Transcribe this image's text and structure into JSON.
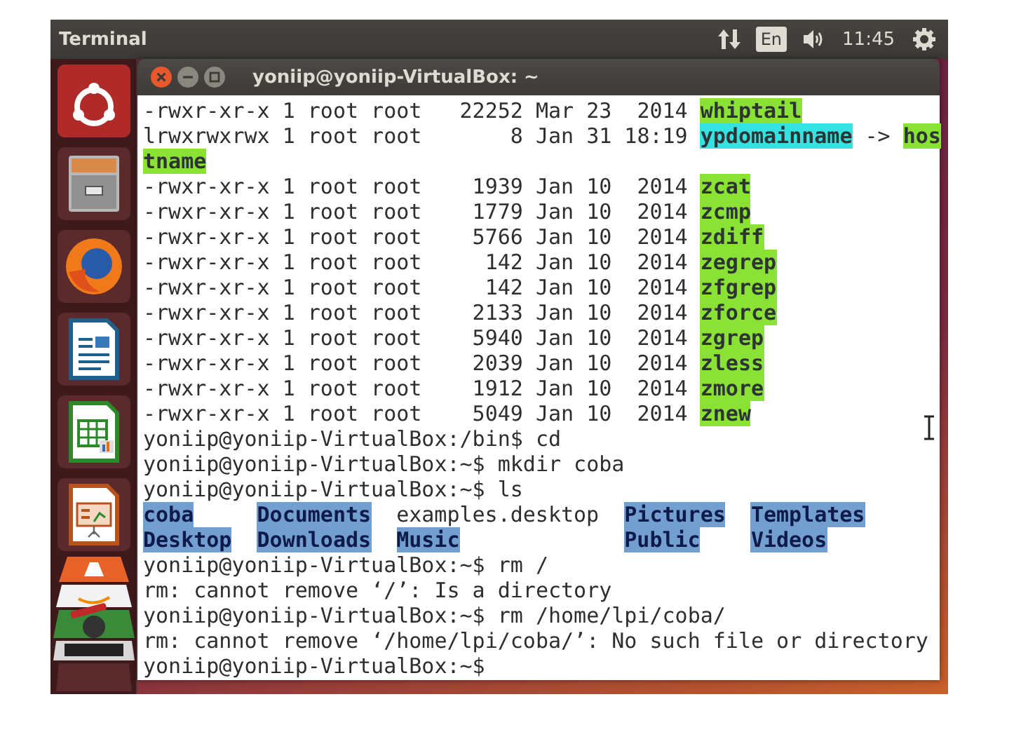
{
  "panel": {
    "app_title": "Terminal",
    "keyboard_layout": "En",
    "clock": "11:45"
  },
  "window": {
    "title": "yoniip@yoniip-VirtualBox: ~"
  },
  "terminal": {
    "lines": [
      [
        {
          "kind": "plain",
          "text": "-rwxr-xr-x 1 root root   22252 Mar 23  2014 "
        },
        {
          "kind": "exec",
          "text": "whiptail"
        }
      ],
      [
        {
          "kind": "plain",
          "text": "lrwxrwxrwx 1 root root       8 Jan 31 18:19 "
        },
        {
          "kind": "link",
          "text": "ypdomainname"
        },
        {
          "kind": "plain",
          "text": " -> "
        },
        {
          "kind": "exec",
          "text": "hos"
        }
      ],
      [
        {
          "kind": "exec",
          "text": "tname"
        }
      ],
      [
        {
          "kind": "plain",
          "text": "-rwxr-xr-x 1 root root    1939 Jan 10  2014 "
        },
        {
          "kind": "exec",
          "text": "zcat"
        }
      ],
      [
        {
          "kind": "plain",
          "text": "-rwxr-xr-x 1 root root    1779 Jan 10  2014 "
        },
        {
          "kind": "exec",
          "text": "zcmp"
        }
      ],
      [
        {
          "kind": "plain",
          "text": "-rwxr-xr-x 1 root root    5766 Jan 10  2014 "
        },
        {
          "kind": "exec",
          "text": "zdiff"
        }
      ],
      [
        {
          "kind": "plain",
          "text": "-rwxr-xr-x 1 root root     142 Jan 10  2014 "
        },
        {
          "kind": "exec",
          "text": "zegrep"
        }
      ],
      [
        {
          "kind": "plain",
          "text": "-rwxr-xr-x 1 root root     142 Jan 10  2014 "
        },
        {
          "kind": "exec",
          "text": "zfgrep"
        }
      ],
      [
        {
          "kind": "plain",
          "text": "-rwxr-xr-x 1 root root    2133 Jan 10  2014 "
        },
        {
          "kind": "exec",
          "text": "zforce"
        }
      ],
      [
        {
          "kind": "plain",
          "text": "-rwxr-xr-x 1 root root    5940 Jan 10  2014 "
        },
        {
          "kind": "exec",
          "text": "zgrep"
        }
      ],
      [
        {
          "kind": "plain",
          "text": "-rwxr-xr-x 1 root root    2039 Jan 10  2014 "
        },
        {
          "kind": "exec",
          "text": "zless"
        }
      ],
      [
        {
          "kind": "plain",
          "text": "-rwxr-xr-x 1 root root    1912 Jan 10  2014 "
        },
        {
          "kind": "exec",
          "text": "zmore"
        }
      ],
      [
        {
          "kind": "plain",
          "text": "-rwxr-xr-x 1 root root    5049 Jan 10  2014 "
        },
        {
          "kind": "exec",
          "text": "znew"
        }
      ],
      [
        {
          "kind": "plain",
          "text": "yoniip@yoniip-VirtualBox:/bin$ cd"
        }
      ],
      [
        {
          "kind": "plain",
          "text": "yoniip@yoniip-VirtualBox:~$ mkdir coba"
        }
      ],
      [
        {
          "kind": "plain",
          "text": "yoniip@yoniip-VirtualBox:~$ ls"
        }
      ],
      {
        "kind": "columns",
        "cells": [
          {
            "kind": "dir",
            "text": "coba"
          },
          {
            "kind": "dir",
            "text": "Documents"
          },
          {
            "kind": "plain",
            "text": "examples.desktop"
          },
          {
            "kind": "dir",
            "text": "Pictures"
          },
          {
            "kind": "dir",
            "text": "Templates"
          }
        ]
      },
      {
        "kind": "columns",
        "cells": [
          {
            "kind": "dir",
            "text": "Desktop"
          },
          {
            "kind": "dir",
            "text": "Downloads"
          },
          {
            "kind": "dir",
            "text": "Music"
          },
          {
            "kind": "dir",
            "text": "Public"
          },
          {
            "kind": "dir",
            "text": "Videos"
          }
        ]
      },
      [
        {
          "kind": "plain",
          "text": "yoniip@yoniip-VirtualBox:~$ rm /"
        }
      ],
      [
        {
          "kind": "plain",
          "text": "rm: cannot remove ‘/’: Is a directory"
        }
      ],
      [
        {
          "kind": "plain",
          "text": "yoniip@yoniip-VirtualBox:~$ rm /home/lpi/coba/"
        }
      ],
      [
        {
          "kind": "plain",
          "text": "rm: cannot remove ‘/home/lpi/coba/’: No such file or directory"
        }
      ],
      [
        {
          "kind": "plain",
          "text": "yoniip@yoniip-VirtualBox:~$"
        }
      ]
    ]
  }
}
